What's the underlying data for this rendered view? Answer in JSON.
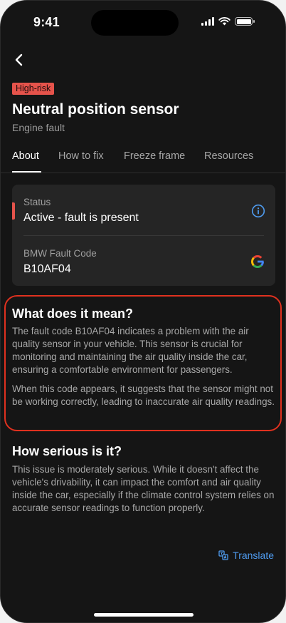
{
  "status_bar": {
    "time": "9:41"
  },
  "header": {
    "badge": "High-risk",
    "title": "Neutral position sensor",
    "subtitle": "Engine fault"
  },
  "tabs": [
    {
      "label": "About",
      "active": true
    },
    {
      "label": "How to fix",
      "active": false
    },
    {
      "label": "Freeze frame",
      "active": false
    },
    {
      "label": "Resources",
      "active": false
    }
  ],
  "card": {
    "status_label": "Status",
    "status_value": "Active - fault is present",
    "code_label": "BMW Fault Code",
    "code_value": "B10AF04"
  },
  "meaning": {
    "heading": "What does it mean?",
    "paragraph1": "The fault code B10AF04 indicates a problem with the air quality sensor in your vehicle. This sensor is crucial for monitoring and maintaining the air quality inside the car, ensuring a comfortable environment for passengers.",
    "paragraph2": "When this code appears, it suggests that the sensor might not be working correctly, leading to inaccurate air quality readings."
  },
  "serious": {
    "heading": "How serious is it?",
    "paragraph": "This issue is moderately serious. While it doesn't affect the vehicle's drivability, it can impact the comfort and air quality inside the car, especially if the climate control system relies on accurate sensor readings to function properly."
  },
  "translate_label": "Translate",
  "colors": {
    "background": "#151515",
    "card": "#252525",
    "risk_red": "#e5534b",
    "highlight_red": "#e0311f",
    "link_blue": "#4f9cf0"
  },
  "icons": [
    "back-chevron-icon",
    "info-icon",
    "google-icon",
    "translate-icon",
    "signal-icon",
    "wifi-icon",
    "battery-icon"
  ]
}
